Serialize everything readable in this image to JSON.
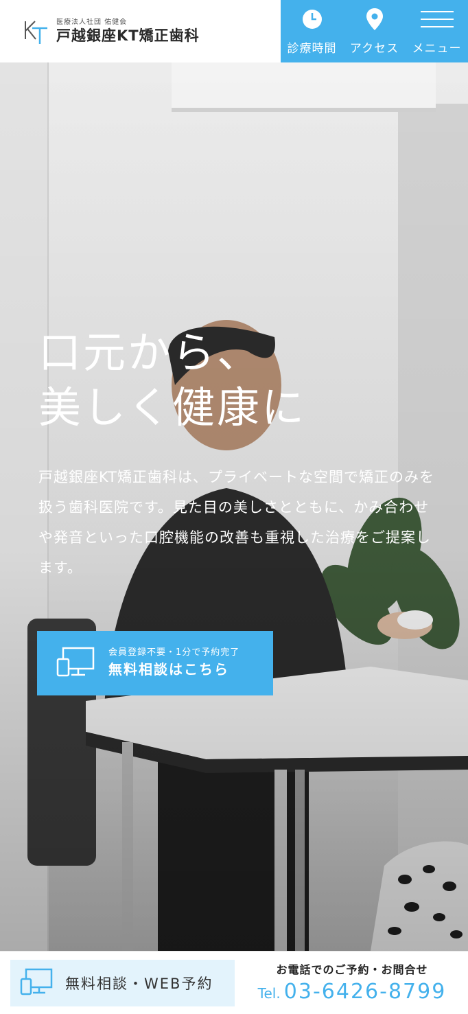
{
  "header": {
    "logo_sub": "医療法人社団 佑健会",
    "logo_main": "戸越銀座KT矯正歯科",
    "nav": [
      {
        "label": "診療時間",
        "icon": "clock-icon"
      },
      {
        "label": "アクセス",
        "icon": "map-pin-icon"
      },
      {
        "label": "メニュー",
        "icon": "hamburger-menu-icon"
      }
    ]
  },
  "hero": {
    "title_line1": "口元から、",
    "title_line2": "美しく健康に",
    "description": "戸越銀座KT矯正歯科は、プライベートな空間で矯正のみを扱う歯科医院です。見た目の美しさとともに、かみ合わせや発音といった口腔機能の改善も重視した治療をご提案します。",
    "cta_small": "会員登録不要・1分で予約完了",
    "cta_large": "無料相談はこちら",
    "cta_icon": "devices-icon"
  },
  "bottom_bar": {
    "web_label": "無料相談・WEB予約",
    "web_icon": "devices-icon",
    "tel_caption": "お電話でのご予約・お問合せ",
    "tel_prefix": "Tel.",
    "tel_number": "03-6426-8799"
  },
  "colors": {
    "accent": "#44b1ec",
    "accent_light": "#e3f3fc",
    "text_dark": "#2a2a2a"
  }
}
